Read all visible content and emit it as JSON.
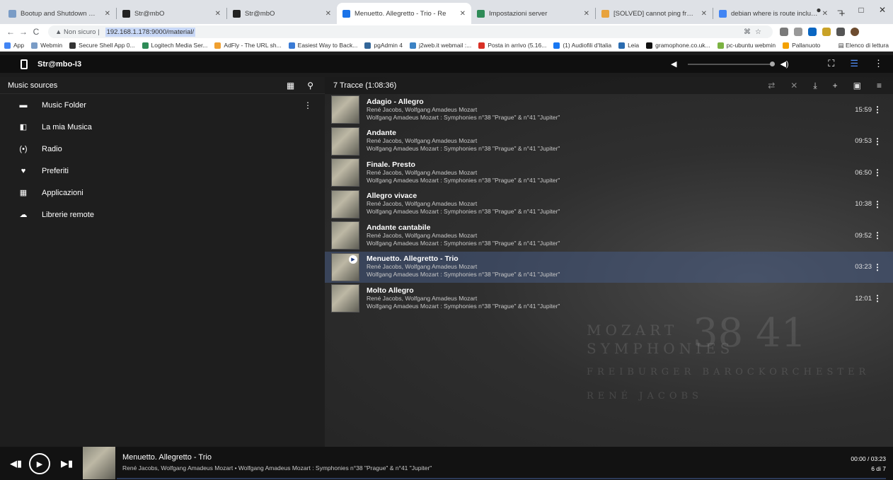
{
  "browser": {
    "tabs": [
      {
        "title": "Bootup and Shutdown — Webm",
        "color": "#7a9cc6",
        "active": false
      },
      {
        "title": "Str@mbO",
        "color": "#222222",
        "active": false
      },
      {
        "title": "Str@mbO",
        "color": "#222222",
        "active": false
      },
      {
        "title": "Menuetto. Allegretto - Trio - Re",
        "color": "#1a73e8",
        "active": true
      },
      {
        "title": "Impostazioni server",
        "color": "#2e8b57",
        "active": false
      },
      {
        "title": "[SOLVED] cannot ping from serv",
        "color": "#e8a33d",
        "active": false
      },
      {
        "title": "debian where is route included",
        "color": "#4285f4",
        "active": false
      }
    ],
    "url_prefix": "Non sicuro",
    "url": "192.168.1.178:9000/material/",
    "bookmarks": [
      {
        "label": "App",
        "color": "#4285f4"
      },
      {
        "label": "Webmin",
        "color": "#7a9cc6"
      },
      {
        "label": "Secure Shell App 0...",
        "color": "#333333"
      },
      {
        "label": "Logitech Media Ser...",
        "color": "#2e8b57"
      },
      {
        "label": "AdFly - The URL sh...",
        "color": "#f0a030"
      },
      {
        "label": "Easiest Way to Back...",
        "color": "#3a7bd5"
      },
      {
        "label": "pgAdmin 4",
        "color": "#336699"
      },
      {
        "label": "j2web.it webmail :...",
        "color": "#3b82c4"
      },
      {
        "label": "Posta in arrivo (5.16...",
        "color": "#d93025"
      },
      {
        "label": "(1) Audiofili d'Italia",
        "color": "#1877f2"
      },
      {
        "label": "Leia",
        "color": "#2b6cb0"
      },
      {
        "label": "gramophone.co.uk...",
        "color": "#111111"
      },
      {
        "label": "pc-ubuntu webmin",
        "color": "#7cb342"
      },
      {
        "label": "Pallanuoto",
        "color": "#f4a100"
      }
    ],
    "reading_list": "Elenco di lettura"
  },
  "app": {
    "name": "Str@mbo-I3",
    "left_title": "Music sources",
    "nav": [
      {
        "label": "Music Folder",
        "icon": "folder-icon",
        "glyph": "▬"
      },
      {
        "label": "La mia Musica",
        "icon": "library-icon",
        "glyph": "◧"
      },
      {
        "label": "Radio",
        "icon": "radio-icon",
        "glyph": "(•)"
      },
      {
        "label": "Preferiti",
        "icon": "heart-icon",
        "glyph": "♥"
      },
      {
        "label": "Applicazioni",
        "icon": "apps-icon",
        "glyph": "▦"
      },
      {
        "label": "Librerie remote",
        "icon": "cloud-icon",
        "glyph": "☁"
      }
    ],
    "queue_title": "7 Tracce (1:08:36)",
    "artist": "René Jacobs, Wolfgang Amadeus Mozart",
    "album": "Wolfgang Amadeus Mozart : Symphonies n°38 \"Prague\" & n°41 \"Jupiter\"",
    "tracks": [
      {
        "title": "Adagio - Allegro",
        "duration": "15:59"
      },
      {
        "title": "Andante",
        "duration": "09:53"
      },
      {
        "title": "Finale. Presto",
        "duration": "06:50"
      },
      {
        "title": "Allegro vivace",
        "duration": "10:38"
      },
      {
        "title": "Andante cantabile",
        "duration": "09:52"
      },
      {
        "title": "Menuetto. Allegretto - Trio",
        "duration": "03:23"
      },
      {
        "title": "Molto Allegro",
        "duration": "12:01"
      }
    ],
    "current_index": 5,
    "background_art": [
      "MOZART",
      "SYMPHONIES",
      "FREIBURGER BAROCKORCHESTER",
      "RENÉ JACOBS"
    ],
    "background_numbers": "38 41"
  },
  "player": {
    "title": "Menuetto. Allegretto - Trio",
    "subtitle": "René Jacobs, Wolfgang Amadeus Mozart • Wolfgang Amadeus Mozart : Symphonies n°38 \"Prague\" & n°41 \"Jupiter\"",
    "time": "00:00 / 03:23",
    "position": "6 di 7",
    "progress": 0.0
  }
}
